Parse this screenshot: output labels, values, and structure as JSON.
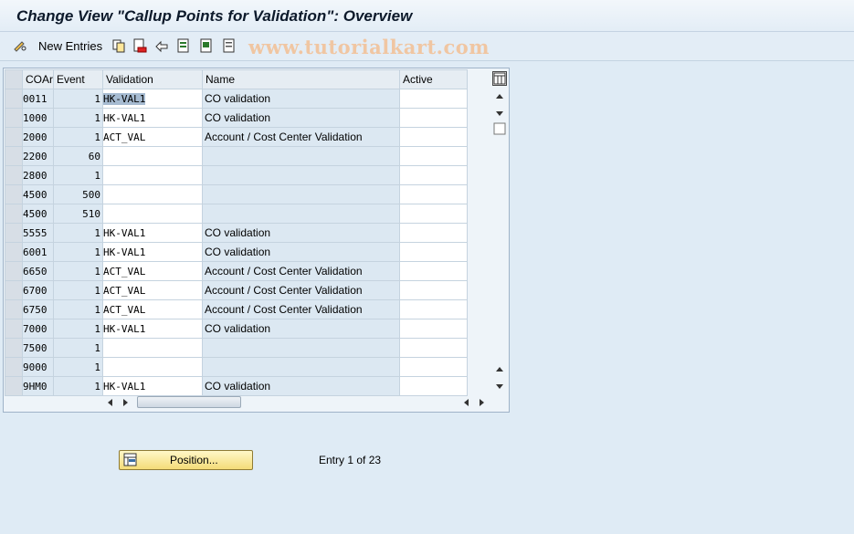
{
  "window": {
    "title": "Change View \"Callup Points for Validation\": Overview"
  },
  "toolbar": {
    "new_entries_label": "New Entries",
    "watermark": "www.tutorialkart.com"
  },
  "table": {
    "columns": [
      "COAr",
      "Event",
      "Validation",
      "Name",
      "Active"
    ],
    "rows": [
      {
        "coar": "0011",
        "event": "1",
        "validation": "HK-VAL1",
        "name": "CO validation",
        "active": ""
      },
      {
        "coar": "1000",
        "event": "1",
        "validation": "HK-VAL1",
        "name": "CO validation",
        "active": ""
      },
      {
        "coar": "2000",
        "event": "1",
        "validation": "ACT_VAL",
        "name": "Account / Cost Center Validation",
        "active": ""
      },
      {
        "coar": "2200",
        "event": "60",
        "validation": "",
        "name": "",
        "active": ""
      },
      {
        "coar": "2800",
        "event": "1",
        "validation": "",
        "name": "",
        "active": ""
      },
      {
        "coar": "4500",
        "event": "500",
        "validation": "",
        "name": "",
        "active": ""
      },
      {
        "coar": "4500",
        "event": "510",
        "validation": "",
        "name": "",
        "active": ""
      },
      {
        "coar": "5555",
        "event": "1",
        "validation": "HK-VAL1",
        "name": "CO validation",
        "active": ""
      },
      {
        "coar": "6001",
        "event": "1",
        "validation": "HK-VAL1",
        "name": "CO validation",
        "active": ""
      },
      {
        "coar": "6650",
        "event": "1",
        "validation": "ACT_VAL",
        "name": "Account / Cost Center Validation",
        "active": ""
      },
      {
        "coar": "6700",
        "event": "1",
        "validation": "ACT_VAL",
        "name": "Account / Cost Center Validation",
        "active": ""
      },
      {
        "coar": "6750",
        "event": "1",
        "validation": "ACT_VAL",
        "name": "Account / Cost Center Validation",
        "active": ""
      },
      {
        "coar": "7000",
        "event": "1",
        "validation": "HK-VAL1",
        "name": "CO validation",
        "active": ""
      },
      {
        "coar": "7500",
        "event": "1",
        "validation": "",
        "name": "",
        "active": ""
      },
      {
        "coar": "9000",
        "event": "1",
        "validation": "",
        "name": "",
        "active": ""
      },
      {
        "coar": "9HM0",
        "event": "1",
        "validation": "HK-VAL1",
        "name": "CO validation",
        "active": ""
      }
    ]
  },
  "footer": {
    "position_label": "Position...",
    "entry_text": "Entry 1 of 23"
  },
  "icons": [
    "pencil-glasses-icon",
    "copy-icon",
    "delete-icon",
    "undo-icon",
    "select-all-icon",
    "select-block-icon",
    "deselect-icon",
    "table-settings-icon",
    "position-icon"
  ]
}
